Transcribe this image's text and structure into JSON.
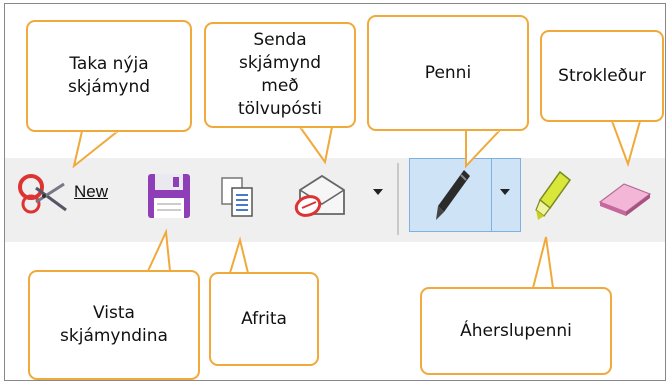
{
  "callouts": {
    "new_snip": "Taka nýja skjámynd",
    "email": "Senda skjámynd með tölvupósti",
    "pen": "Penni",
    "eraser": "Strokleður",
    "save": "Vista skjámyndina",
    "copy": "Afrita",
    "highlighter": "Áherslupenni"
  },
  "toolbar": {
    "new_label": "New",
    "icons": [
      "scissors-icon",
      "save-icon",
      "copy-icon",
      "email-icon",
      "pen-icon",
      "highlighter-icon",
      "eraser-icon"
    ]
  },
  "colors": {
    "callout_border": "#f0a93a",
    "toolbar_bg": "#efefef",
    "pen_active": "#cfe3f7"
  }
}
